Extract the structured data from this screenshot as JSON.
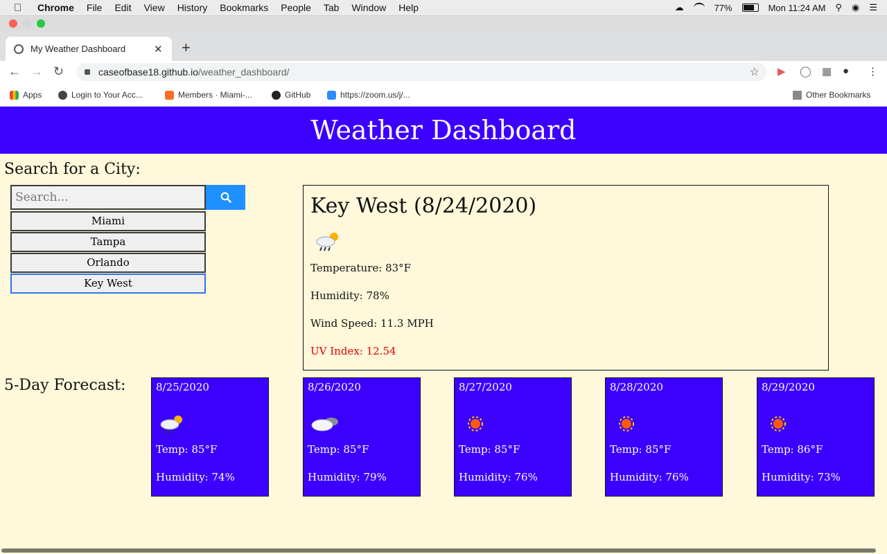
{
  "menubar": {
    "app": "Chrome",
    "items": [
      "File",
      "Edit",
      "View",
      "History",
      "Bookmarks",
      "People",
      "Tab",
      "Window",
      "Help"
    ],
    "battery": "77%",
    "clock": "Mon 11:24 AM"
  },
  "browser": {
    "tab_title": "My Weather Dashboard",
    "url_host": "caseofbase18.github.io",
    "url_path": "/weather_dashboard/",
    "bookmarks": [
      "Apps",
      "Login to Your Acc...",
      "Members · Miami-...",
      "GitHub",
      "https://zoom.us/j/..."
    ],
    "other_bookmarks": "Other Bookmarks"
  },
  "page": {
    "title": "Weather Dashboard",
    "search_heading": "Search for a City:",
    "search_placeholder": "Search...",
    "cities": [
      "Miami",
      "Tampa",
      "Orlando",
      "Key West"
    ],
    "current": {
      "title": "Key West (8/24/2020)",
      "icon": "rain-sun-icon",
      "temperature": "Temperature: 83°F",
      "humidity": "Humidity: 78%",
      "wind": "Wind Speed: 11.3 MPH",
      "uv": "UV Index: 12.54"
    },
    "forecast_heading": "5-Day Forecast:",
    "forecast": [
      {
        "date": "8/25/2020",
        "icon": "rain-sun-icon",
        "temp": "Temp: 85°F",
        "humidity": "Humidity: 74%"
      },
      {
        "date": "8/26/2020",
        "icon": "cloud-icon",
        "temp": "Temp: 85°F",
        "humidity": "Humidity: 79%"
      },
      {
        "date": "8/27/2020",
        "icon": "sun-icon",
        "temp": "Temp: 85°F",
        "humidity": "Humidity: 76%"
      },
      {
        "date": "8/28/2020",
        "icon": "sun-icon",
        "temp": "Temp: 85°F",
        "humidity": "Humidity: 76%"
      },
      {
        "date": "8/29/2020",
        "icon": "sun-icon",
        "temp": "Temp: 86°F",
        "humidity": "Humidity: 73%"
      }
    ]
  },
  "colors": {
    "banner": "#3c00ff",
    "page_bg": "#fff8db",
    "search_button": "#1e90ff",
    "uv_text": "#e00000"
  }
}
